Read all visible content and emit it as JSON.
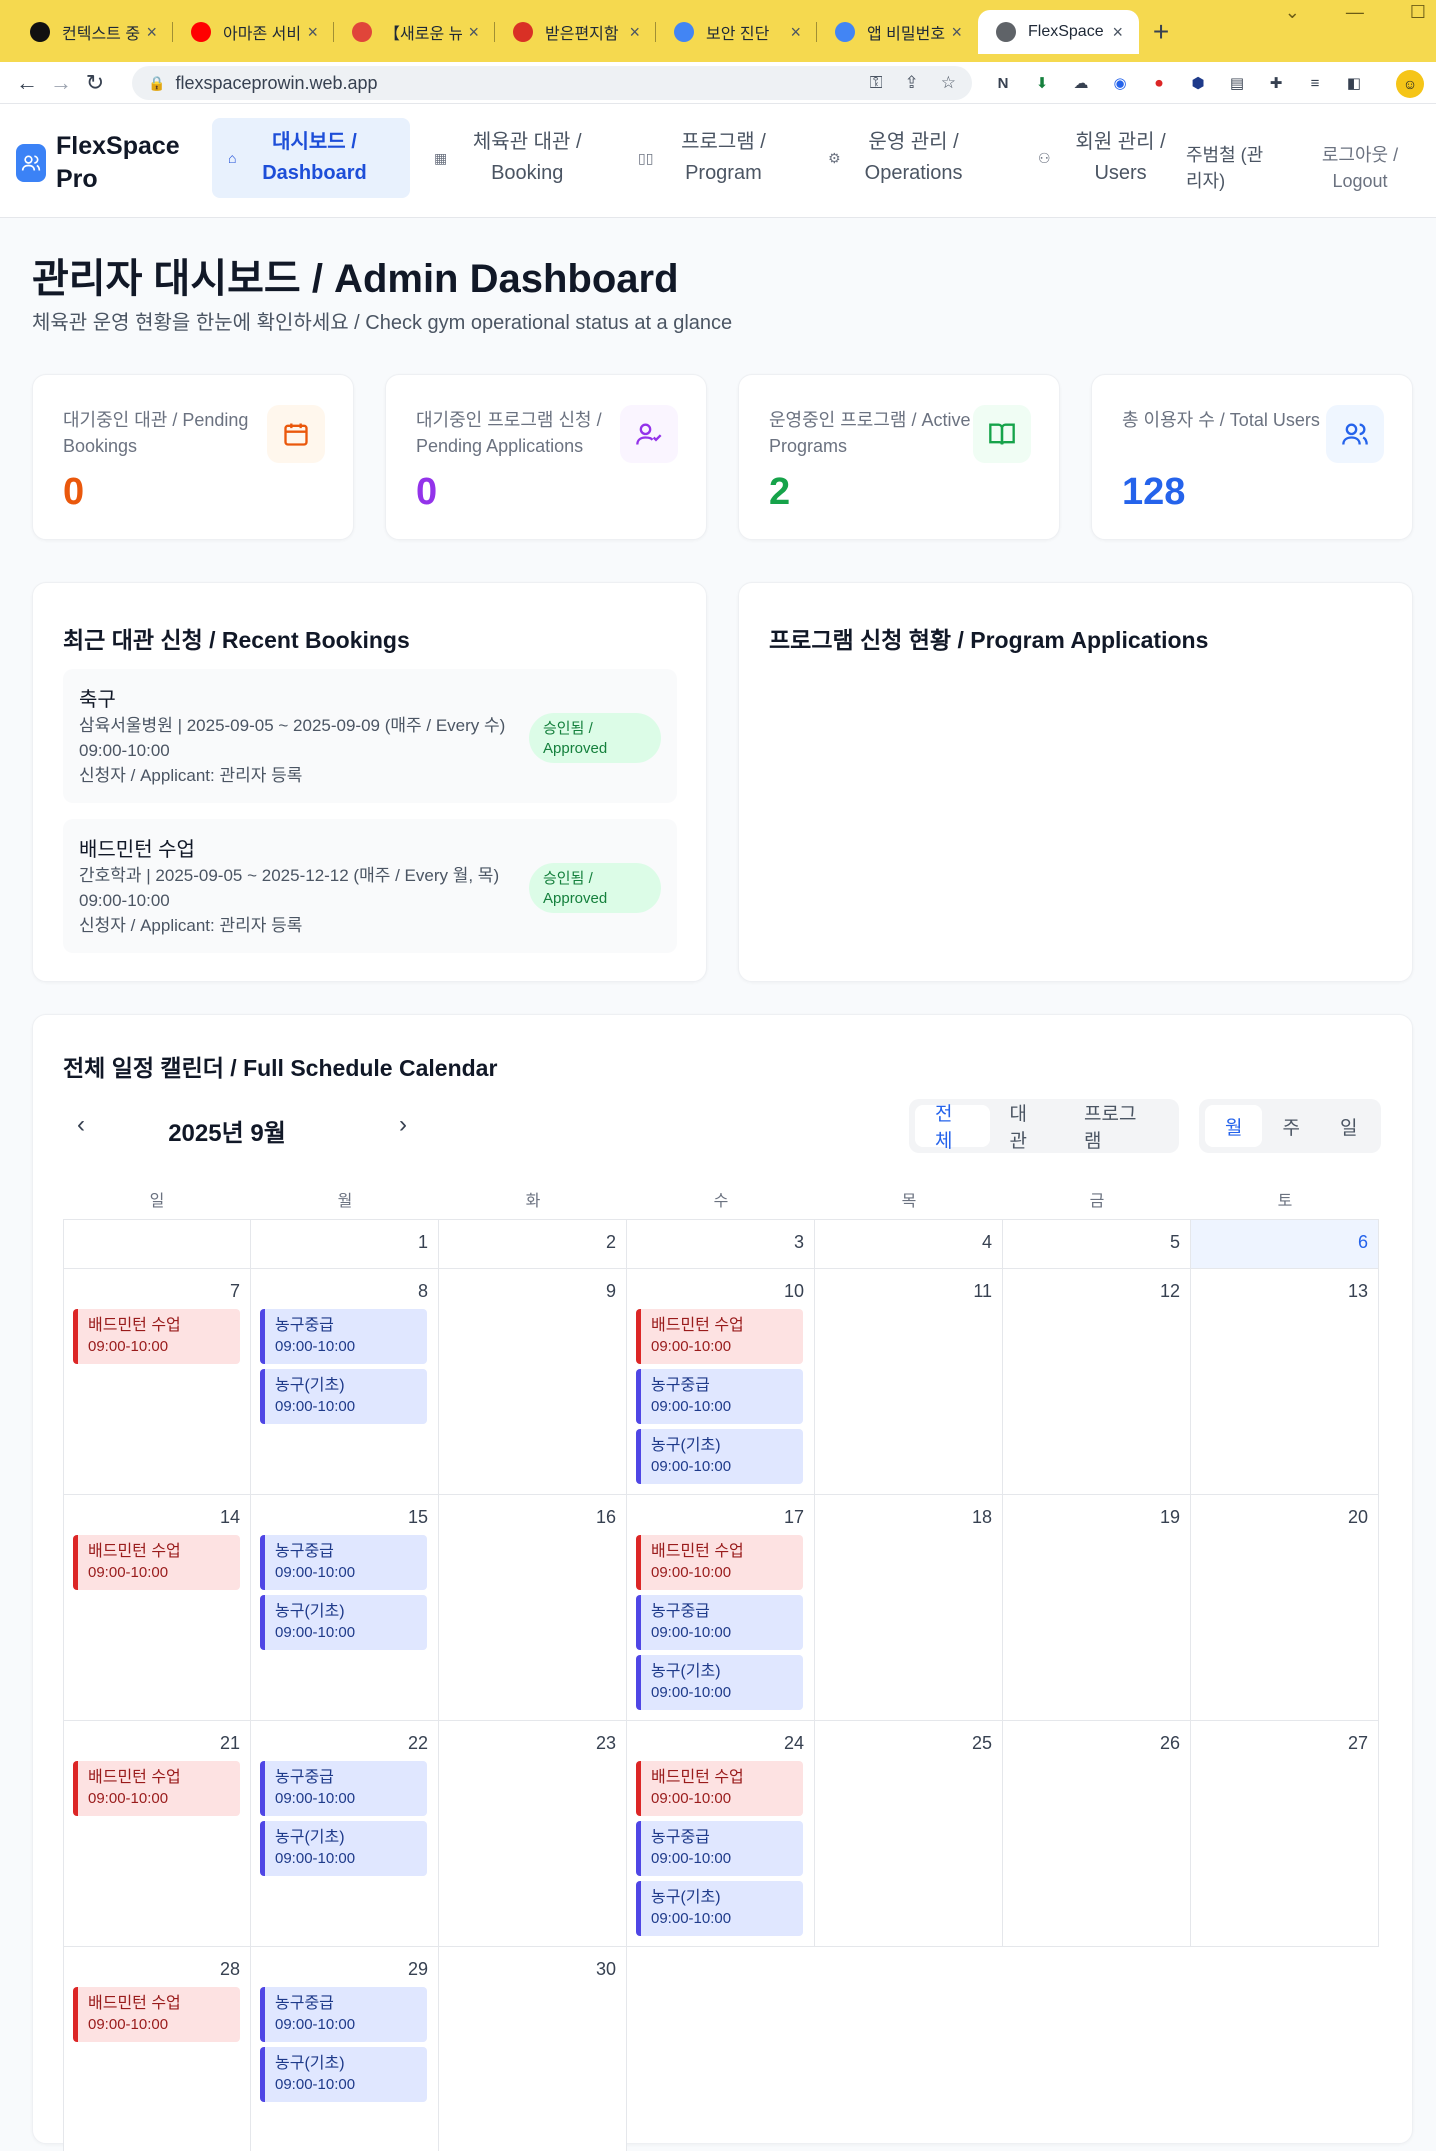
{
  "browser": {
    "tabs": [
      {
        "title": "컨텍스트 중",
        "icon": "openai-icon",
        "color": "#111111"
      },
      {
        "title": "아마존 서비",
        "icon": "youtube-icon",
        "color": "#ff0000"
      },
      {
        "title": "【새로운 뉴",
        "icon": "gg-icon",
        "color": "#e0453a"
      },
      {
        "title": "받은편지함",
        "icon": "gmail-icon",
        "color": "#d93025"
      },
      {
        "title": "보안 진단",
        "icon": "google-icon",
        "color": "#4285f4"
      },
      {
        "title": "앱 비밀번호",
        "icon": "google-icon",
        "color": "#4285f4"
      },
      {
        "title": "FlexSpace",
        "icon": "globe-icon",
        "color": "#5f6368"
      }
    ],
    "url": "flexspaceprowin.web.app"
  },
  "nav": {
    "brand": "FlexSpace Pro",
    "items": [
      {
        "label": "대시보드 / Dashboard",
        "icon": "home-icon"
      },
      {
        "label": "체육관 대관 / Booking",
        "icon": "calendar-icon"
      },
      {
        "label": "프로그램 / Program",
        "icon": "book-icon"
      },
      {
        "label": "운영 관리 / Operations",
        "icon": "gear-icon"
      },
      {
        "label": "회원 관리 / Users",
        "icon": "users-icon"
      }
    ],
    "user": "주범철 (관리자)",
    "logout": "로그아웃 / Logout"
  },
  "header": {
    "title": "관리자 대시보드 / Admin Dashboard",
    "subtitle": "체육관 운영 현황을 한눈에 확인하세요 / Check gym operational status at a glance"
  },
  "stats": [
    {
      "label": "대기중인 대관 / Pending Bookings",
      "value": "0",
      "color": "#ea580c",
      "icon_bg": "#fff7ed",
      "icon": "calendar-icon"
    },
    {
      "label": "대기중인 프로그램 신청 / Pending Applications",
      "value": "0",
      "color": "#9333ea",
      "icon_bg": "#faf5ff",
      "icon": "user-check-icon"
    },
    {
      "label": "운영중인 프로그램 / Active Programs",
      "value": "2",
      "color": "#16a34a",
      "icon_bg": "#f0fdf4",
      "icon": "book-open-icon"
    },
    {
      "label": "총 이용자 수 / Total Users",
      "value": "128",
      "color": "#2563eb",
      "icon_bg": "#eff6ff",
      "icon": "users-icon"
    }
  ],
  "recent_bookings": {
    "title": "최근 대관 신청 / Recent Bookings",
    "items": [
      {
        "title": "축구",
        "info": "삼육서울병원 | 2025-09-05 ~ 2025-09-09 (매주 / Every 수) 09:00-10:00",
        "applicant": "신청자 / Applicant: 관리자 등록",
        "status": "승인됨 / Approved"
      },
      {
        "title": "배드민턴 수업",
        "info": "간호학과 | 2025-09-05 ~ 2025-12-12 (매주 / Every 월, 목) 09:00-10:00",
        "applicant": "신청자 / Applicant: 관리자 등록",
        "status": "승인됨 / Approved"
      }
    ]
  },
  "program_apps": {
    "title": "프로그램 신청 현황 / Program Applications"
  },
  "calendar": {
    "title": "전체 일정 캘린더 / Full Schedule Calendar",
    "month": "2025년 9월",
    "filters": [
      "전체",
      "대관",
      "프로그램"
    ],
    "views": [
      "월",
      "주",
      "일"
    ],
    "weekdays": [
      "일",
      "월",
      "화",
      "수",
      "목",
      "금",
      "토"
    ],
    "days": [
      {
        "d": "1",
        "events": []
      },
      {
        "d": "2",
        "events": []
      },
      {
        "d": "3",
        "events": []
      },
      {
        "d": "4",
        "events": []
      },
      {
        "d": "5",
        "events": []
      },
      {
        "d": "6",
        "events": [],
        "today": true
      },
      {
        "d": "7",
        "events": [
          {
            "t": "배드민턴 수업",
            "time": "09:00-10:00",
            "c": "red"
          }
        ]
      },
      {
        "d": "8",
        "events": [
          {
            "t": "농구중급",
            "time": "09:00-10:00",
            "c": "blue"
          },
          {
            "t": "농구(기초)",
            "time": "09:00-10:00",
            "c": "blue"
          }
        ]
      },
      {
        "d": "9",
        "events": []
      },
      {
        "d": "10",
        "events": [
          {
            "t": "배드민턴 수업",
            "time": "09:00-10:00",
            "c": "red"
          },
          {
            "t": "농구중급",
            "time": "09:00-10:00",
            "c": "blue"
          },
          {
            "t": "농구(기초)",
            "time": "09:00-10:00",
            "c": "blue"
          }
        ]
      },
      {
        "d": "11",
        "events": []
      },
      {
        "d": "12",
        "events": []
      },
      {
        "d": "13",
        "events": []
      },
      {
        "d": "14",
        "events": [
          {
            "t": "배드민턴 수업",
            "time": "09:00-10:00",
            "c": "red"
          }
        ]
      },
      {
        "d": "15",
        "events": [
          {
            "t": "농구중급",
            "time": "09:00-10:00",
            "c": "blue"
          },
          {
            "t": "농구(기초)",
            "time": "09:00-10:00",
            "c": "blue"
          }
        ]
      },
      {
        "d": "16",
        "events": []
      },
      {
        "d": "17",
        "events": [
          {
            "t": "배드민턴 수업",
            "time": "09:00-10:00",
            "c": "red"
          },
          {
            "t": "농구중급",
            "time": "09:00-10:00",
            "c": "blue"
          },
          {
            "t": "농구(기초)",
            "time": "09:00-10:00",
            "c": "blue"
          }
        ]
      },
      {
        "d": "18",
        "events": []
      },
      {
        "d": "19",
        "events": []
      },
      {
        "d": "20",
        "events": []
      },
      {
        "d": "21",
        "events": [
          {
            "t": "배드민턴 수업",
            "time": "09:00-10:00",
            "c": "red"
          }
        ]
      },
      {
        "d": "22",
        "events": [
          {
            "t": "농구중급",
            "time": "09:00-10:00",
            "c": "blue"
          },
          {
            "t": "농구(기초)",
            "time": "09:00-10:00",
            "c": "blue"
          }
        ]
      },
      {
        "d": "23",
        "events": []
      },
      {
        "d": "24",
        "events": [
          {
            "t": "배드민턴 수업",
            "time": "09:00-10:00",
            "c": "red"
          },
          {
            "t": "농구중급",
            "time": "09:00-10:00",
            "c": "blue"
          },
          {
            "t": "농구(기초)",
            "time": "09:00-10:00",
            "c": "blue"
          }
        ]
      },
      {
        "d": "25",
        "events": []
      },
      {
        "d": "26",
        "events": []
      },
      {
        "d": "27",
        "events": []
      },
      {
        "d": "28",
        "events": [
          {
            "t": "배드민턴 수업",
            "time": "09:00-10:00",
            "c": "red"
          }
        ]
      },
      {
        "d": "29",
        "events": [
          {
            "t": "농구중급",
            "time": "09:00-10:00",
            "c": "blue"
          },
          {
            "t": "농구(기초)",
            "time": "09:00-10:00",
            "c": "blue"
          }
        ]
      },
      {
        "d": "30",
        "events": []
      }
    ]
  }
}
